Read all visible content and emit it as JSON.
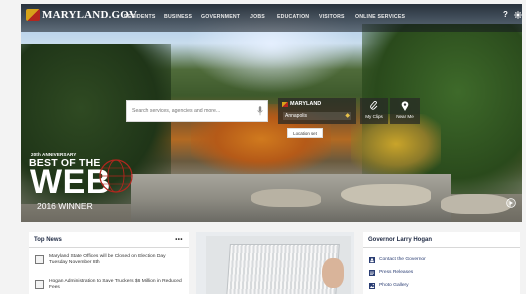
{
  "header": {
    "logo_text": "MARYLAND.GOV",
    "nav": [
      "RESIDENTS",
      "BUSINESS",
      "GOVERNMENT",
      "JOBS",
      "EDUCATION",
      "VISITORS",
      "ONLINE SERVICES"
    ],
    "icons": [
      "help-icon",
      "settings-icon"
    ]
  },
  "search": {
    "placeholder": "Search services, agencies and more...",
    "location_state": "MARYLAND",
    "location_city": "Annapolis",
    "my_clips_label": "My Clips",
    "near_me_label": "Near Me",
    "tooltip": "Location set"
  },
  "promo": {
    "anniversary": "20th ANNIVERSARY",
    "line1": "BEST OF THE",
    "line2": "WEB",
    "line3": "2016 WINNER"
  },
  "top_news": {
    "title": "Top News",
    "more": "•••",
    "items": [
      "Maryland State Offices will be Closed on Election Day Tuesday November 8th",
      "Hogan Administration to Save Truckers $6 Million in Reduced Fees"
    ]
  },
  "governor": {
    "title": "Governor Larry Hogan",
    "links": [
      "Contact the Governor",
      "Press Releases",
      "Photo Gallery"
    ]
  },
  "colors": {
    "nav_bg": "#141a1e",
    "link_blue": "#2a3d73",
    "card_title": "#1f2a44"
  }
}
